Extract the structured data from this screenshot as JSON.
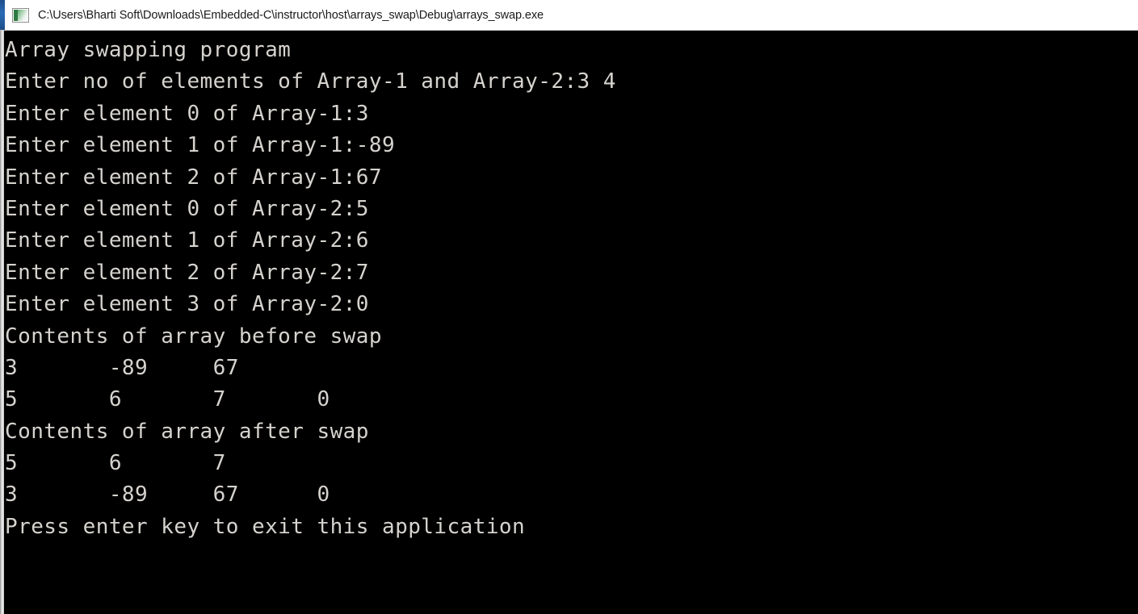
{
  "window": {
    "title": "C:\\Users\\Bharti Soft\\Downloads\\Embedded-C\\instructor\\host\\arrays_swap\\Debug\\arrays_swap.exe",
    "icon": "console-icon",
    "title_bar_background": "#ffffff",
    "title_text_color": "#1a1a1a",
    "accent_color": "#1f4e8c"
  },
  "console": {
    "background": "#000000",
    "foreground": "#d6d3ce",
    "font_size_px": 26,
    "line_height_px": 39.4,
    "tab_width_chars": 8,
    "lines": [
      "Array swapping program",
      "Enter no of elements of Array-1 and Array-2:3 4",
      "Enter element 0 of Array-1:3",
      "Enter element 1 of Array-1:-89",
      "Enter element 2 of Array-1:67",
      "Enter element 0 of Array-2:5",
      "Enter element 1 of Array-2:6",
      "Enter element 2 of Array-2:7",
      "Enter element 3 of Array-2:0",
      "Contents of array before swap",
      "3       -89     67",
      "5       6       7       0",
      "Contents of array after swap",
      "5       6       7",
      "3       -89     67      0",
      "Press enter key to exit this application"
    ],
    "program": {
      "header": "Array swapping program",
      "prompt_counts": "Enter no of elements of Array-1 and Array-2:",
      "entered_counts": "3 4",
      "array1_length": 3,
      "array2_length": 4,
      "array1_before": [
        3,
        -89,
        67
      ],
      "array2_before": [
        5,
        6,
        7,
        0
      ],
      "array1_after": [
        5,
        6,
        7
      ],
      "array2_after": [
        3,
        -89,
        67,
        0
      ],
      "label_before_swap": "Contents of array before swap",
      "label_after_swap": "Contents of array after swap",
      "exit_prompt": "Press enter key to exit this application"
    }
  }
}
